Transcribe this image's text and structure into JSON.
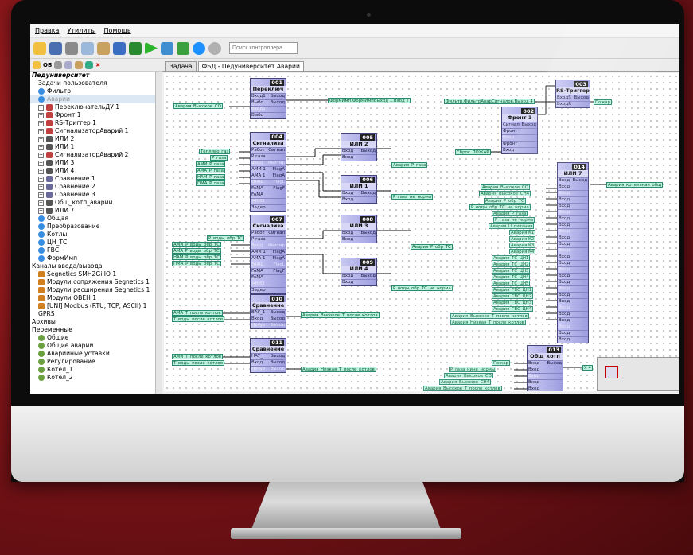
{
  "menu": [
    "Правка",
    "Утилиты",
    "Помощь"
  ],
  "search": {
    "placeholder": "Поиск контроллера"
  },
  "tabs": [
    {
      "label": "Задача"
    },
    {
      "label": "ФБД - Педуниверситет.Аварии"
    }
  ],
  "tree": [
    {
      "label": "Педуниверситет",
      "type": "root"
    },
    {
      "label": "Задачи пользователя",
      "type": "plain",
      "indent": 1
    },
    {
      "label": "Фильтр",
      "type": "task",
      "indent": 1
    },
    {
      "label": "Аварии",
      "type": "task",
      "indent": 1,
      "selected": true
    },
    {
      "label": "ПереключательДУ 1",
      "type": "fb",
      "indent": 1
    },
    {
      "label": "Фронт 1",
      "type": "fb",
      "indent": 1
    },
    {
      "label": "RS-Триггер 1",
      "type": "fb",
      "indent": 1
    },
    {
      "label": "СигнализаторАварий 1",
      "type": "fb",
      "indent": 1
    },
    {
      "label": "ИЛИ 2",
      "type": "or",
      "indent": 1
    },
    {
      "label": "ИЛИ 1",
      "type": "or",
      "indent": 1
    },
    {
      "label": "СигнализаторАварий 2",
      "type": "fb",
      "indent": 1
    },
    {
      "label": "ИЛИ 3",
      "type": "or",
      "indent": 1
    },
    {
      "label": "ИЛИ 4",
      "type": "or",
      "indent": 1
    },
    {
      "label": "Сравнение 1",
      "type": "cmp",
      "indent": 1
    },
    {
      "label": "Сравнение 2",
      "type": "cmp",
      "indent": 1
    },
    {
      "label": "Сравнение 3",
      "type": "cmp",
      "indent": 1
    },
    {
      "label": "Общ_котп_аварии",
      "type": "or",
      "indent": 1
    },
    {
      "label": "ИЛИ 7",
      "type": "or",
      "indent": 1
    },
    {
      "label": "Общая",
      "type": "task",
      "indent": 1
    },
    {
      "label": "Преобразование",
      "type": "task",
      "indent": 1
    },
    {
      "label": "Котлы",
      "type": "task",
      "indent": 1
    },
    {
      "label": "ЦН_ТС",
      "type": "task",
      "indent": 1
    },
    {
      "label": "ГВС",
      "type": "task",
      "indent": 1
    },
    {
      "label": "ФормИмп",
      "type": "task",
      "indent": 1
    },
    {
      "label": "Каналы ввода/вывода",
      "type": "plain",
      "indent": 0
    },
    {
      "label": "Segnetics SMH2Gi IO 1",
      "type": "io",
      "indent": 1
    },
    {
      "label": "Модули сопряжения Segnetics 1",
      "type": "io",
      "indent": 1
    },
    {
      "label": "Модули расширения Segnetics 1",
      "type": "io",
      "indent": 1
    },
    {
      "label": "Модули ОВЕН 1",
      "type": "io",
      "indent": 1
    },
    {
      "label": "[UNI] Modbus (RTU, TCP, ASCII) 1",
      "type": "io",
      "indent": 1
    },
    {
      "label": "GPRS",
      "type": "plain",
      "indent": 1
    },
    {
      "label": "Архивы",
      "type": "plain",
      "indent": 0
    },
    {
      "label": "Переменные",
      "type": "plain",
      "indent": 0
    },
    {
      "label": "Общие",
      "type": "var",
      "indent": 1
    },
    {
      "label": "Общие аварии",
      "type": "var",
      "indent": 1
    },
    {
      "label": "Аварийные уставки",
      "type": "var",
      "indent": 1
    },
    {
      "label": "Регулирование",
      "type": "var",
      "indent": 1
    },
    {
      "label": "Котел_1",
      "type": "var",
      "indent": 1
    },
    {
      "label": "Котел_2",
      "type": "var",
      "indent": 1
    }
  ],
  "blocks": [
    {
      "num": "001",
      "name": "Переключ",
      "pins": [
        "Вход1|Выход",
        "Выбо|Выход",
        "Вход1",
        "Выбо"
      ]
    },
    {
      "num": "004",
      "name": "Сигнализа",
      "pins": [
        "Работ|Сигнал",
        "Р газа",
        "Вход|Квитир",
        "АМИ 1|FlagA",
        "АМА 1|FlagA",
        "FAIRL|FlagL",
        "FAMA|FlagF",
        "FAMA",
        "=НИЗ",
        "Задер"
      ]
    },
    {
      "num": "005",
      "name": "ИЛИ 2",
      "pins": [
        "Вход|Выход",
        "Вход"
      ]
    },
    {
      "num": "006",
      "name": "ИЛИ 1",
      "pins": [
        "Вход|Выход",
        "Вход"
      ]
    },
    {
      "num": "007",
      "name": "Сигнализа",
      "pins": [
        "Работ|Сигнал",
        "Р газа",
        "Вход|Квитир",
        "АМИ 1|FlagA",
        "АМА 1|FlagA",
        "FAIRL|FlagL",
        "FAMA|FlagF",
        "FAMA",
        "=НИЗ",
        "Задер"
      ]
    },
    {
      "num": "008",
      "name": "ИЛИ 3",
      "pins": [
        "Вход|Выход",
        "Вход"
      ]
    },
    {
      "num": "009",
      "name": "ИЛИ 4",
      "pins": [
        "Вход|Выход",
        "Вход"
      ]
    },
    {
      "num": "010",
      "name": "Сравнение",
      "pins": [
        "ВАУ_1|Выход",
        "Вход|Выход",
        "Нечув|Выход"
      ]
    },
    {
      "num": "011",
      "name": "Сравнение",
      "pins": [
        "НАУ_|Выход",
        "Вход|Выход",
        "Нечув|Выход"
      ]
    },
    {
      "num": "002",
      "name": "Фронт 1",
      "pins": [
        "Сигнал|Выход",
        "Фронт",
        "Вход",
        "Фронт",
        "Вход"
      ]
    },
    {
      "num": "003",
      "name": "RS-Триггер",
      "pins": [
        "ВходS|Выход",
        "ВходR"
      ]
    },
    {
      "num": "014",
      "name": "ИЛИ 7",
      "pins": [
        "Вход|Выход",
        "Вход",
        "Вход",
        "Вход",
        "Вход",
        "Вход",
        "Вход",
        "Вход",
        "Вход",
        "Вход",
        "Вход",
        "Вход",
        "Вход",
        "Вход",
        "Вход",
        "Вход",
        "Вход",
        "Вход",
        "Вход",
        "Вход",
        "Вход",
        "Вход",
        "Вход",
        "Вход",
        "Вход",
        "Вход"
      ]
    },
    {
      "num": "013",
      "name": "Общ_котп",
      "pins": [
        "Вход|Выход",
        "Вход",
        "Вход",
        "Вход",
        "Вход",
        "Вход"
      ]
    }
  ],
  "labels": [
    "Авария_Высокое_СО",
    "ФормИмп.ФормИмпВыход 1.Вход Т",
    "Фильтр.ФильтрАварСигналов.Выход 4",
    "Пожар",
    "Топливо_газ",
    "Р_газа",
    "АМИ_Р_газа",
    "АМА_Р_газа",
    "НАМ_Р_газа",
    "ПМА_Р_газа",
    "Авария_Р_газа",
    "Сброс_ПОЖАР",
    "Р_газа_не_норма",
    "Авария_котельная_общ",
    "Авария_Высокое_СО",
    "Авария_Высокое_СН4",
    "Авария_Р_обр_ТС",
    "Р_воды_обр_ТС_не_норма",
    "Авария_Р_газа",
    "Р_газа_не_норма",
    "Авария_U_питания",
    "Авария К1",
    "Авария К2",
    "Авария К3",
    "Авария К4",
    "Авария_ТС_ЦН1",
    "Авария_ТС_ЦН2",
    "Авария_ТС_ЦН3",
    "Авария_ТС_ЦН4",
    "Авария_ТС_ЦН5",
    "Авария_ГВС_ЦН1",
    "Авария_ГВС_ЦН2",
    "Авария_ГВС_ЦН3",
    "Авария_ГВС_ЦН4",
    "Авария_Высокое_Т_после_котлов",
    "Авария_Низкая_Т_после_котлов",
    "Р_воды_обр_ТС",
    "АМИ_Р_воды_обр_ТС",
    "АМА_Р_воды_обр_ТС",
    "НАМ_Р_воды_обр_ТС",
    "ПМА_Р_воды_обр_ТС",
    "Авария_Р_обр_ТС",
    "Р_воды_обр_ТС_не_норма",
    "АМА_Т_после_котлов",
    "Т_воды_после_котлов",
    "Авария_Высокое_Т_после_котлов",
    "АМИ_Т_после_котлов",
    "Т_воды_после_котлов",
    "Авария_Низкая_Т_после_котлов",
    "Пожар",
    "Р_газа_нине_нормы",
    "Авария_Высокое_СО",
    "Авария_Высокое_СН4",
    "Авария_Высокое_Т_после_котлов",
    "X 4"
  ]
}
